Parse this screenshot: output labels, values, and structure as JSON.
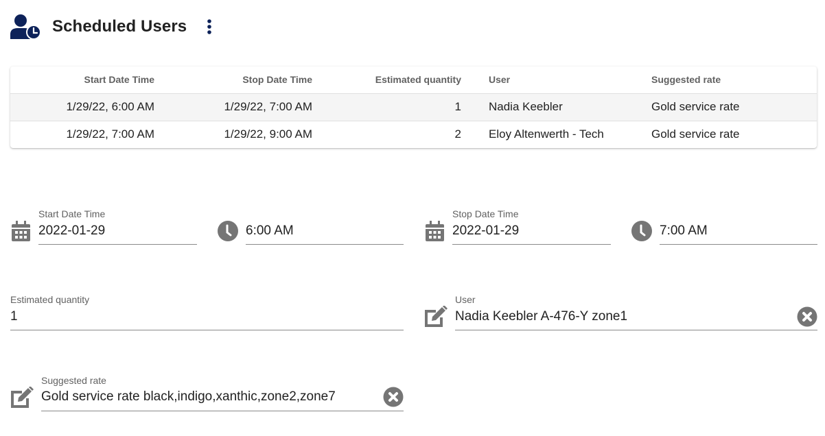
{
  "header": {
    "title": "Scheduled Users",
    "logo_icon": "user-clock-icon",
    "menu_icon": "more-vertical-icon",
    "brand_color": "#0d2259"
  },
  "table": {
    "columns": [
      "Start Date Time",
      "Stop Date Time",
      "Estimated quantity",
      "User",
      "Suggested rate"
    ],
    "rows": [
      [
        "1/29/22, 6:00 AM",
        "1/29/22, 7:00 AM",
        "1",
        "Nadia Keebler",
        "Gold service rate"
      ],
      [
        "1/29/22, 7:00 AM",
        "1/29/22, 9:00 AM",
        "2",
        "Eloy Altenwerth - Tech",
        "Gold service rate"
      ]
    ]
  },
  "form": {
    "start": {
      "label": "Start Date Time",
      "date": "2022-01-29",
      "time": "6:00 AM",
      "date_icon": "calendar-icon",
      "time_icon": "clock-icon"
    },
    "stop": {
      "label": "Stop Date Time",
      "date": "2022-01-29",
      "time": "7:00 AM",
      "date_icon": "calendar-icon",
      "time_icon": "clock-icon"
    },
    "quantity": {
      "label": "Estimated quantity",
      "value": "1"
    },
    "user": {
      "label": "User",
      "value": "Nadia Keebler A-476-Y zone1",
      "edit_icon": "edit-icon",
      "clear_icon": "clear-icon"
    },
    "rate": {
      "label": "Suggested rate",
      "value": "Gold service rate black,indigo,xanthic,zone2,zone7",
      "edit_icon": "edit-icon",
      "clear_icon": "clear-icon"
    }
  }
}
